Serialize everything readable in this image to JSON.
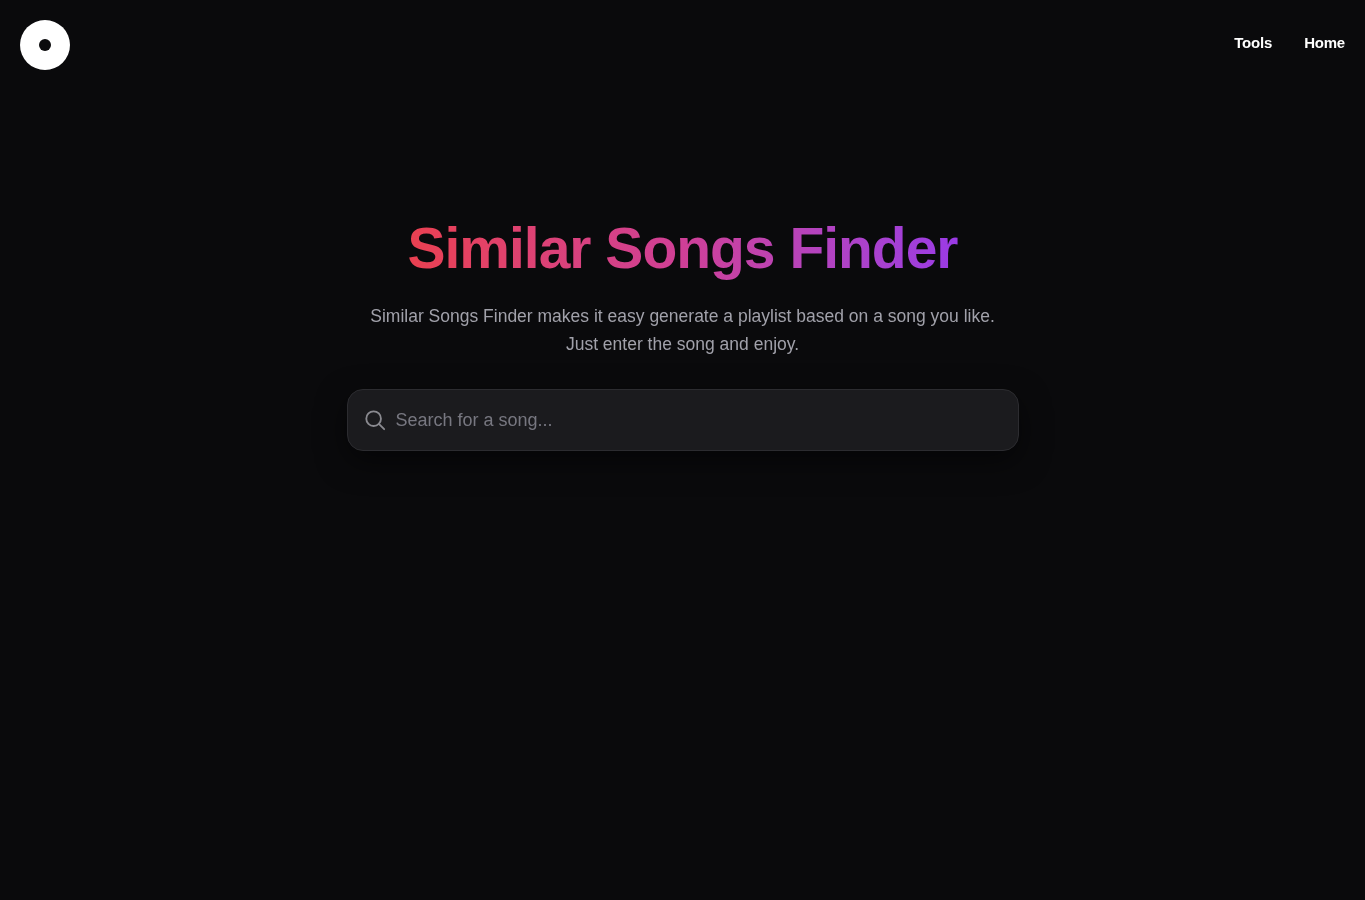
{
  "nav": [
    {
      "label": "Tools"
    },
    {
      "label": "Home"
    }
  ],
  "hero": {
    "title": "Similar Songs Finder",
    "description": "Similar Songs Finder makes it easy generate a playlist based on a song you like. Just enter the song and enjoy."
  },
  "search": {
    "placeholder": "Search for a song..."
  }
}
